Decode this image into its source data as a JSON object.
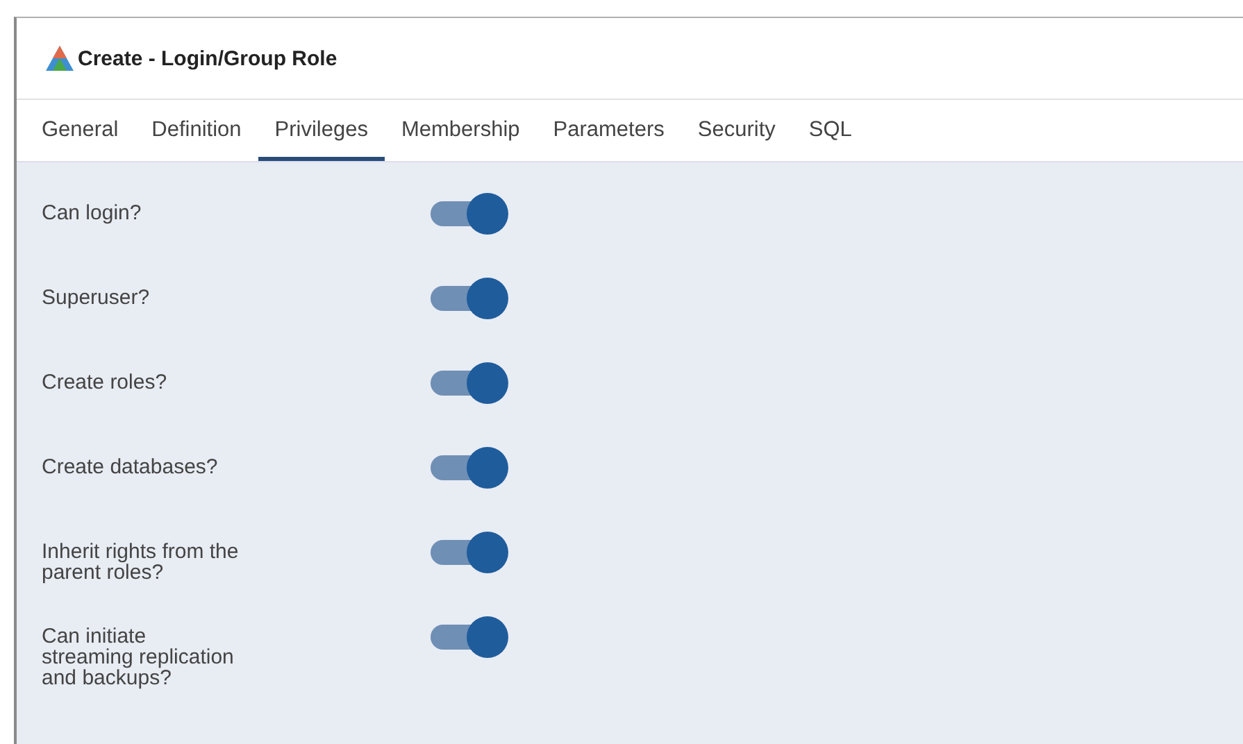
{
  "window": {
    "title": "Create - Login/Group Role"
  },
  "tabs": [
    {
      "label": "General",
      "selected": false
    },
    {
      "label": "Definition",
      "selected": false
    },
    {
      "label": "Privileges",
      "selected": true
    },
    {
      "label": "Membership",
      "selected": false
    },
    {
      "label": "Parameters",
      "selected": false
    },
    {
      "label": "Security",
      "selected": false
    },
    {
      "label": "SQL",
      "selected": false
    }
  ],
  "privileges": [
    {
      "label": "Can login?",
      "on": true
    },
    {
      "label": "Superuser?",
      "on": true
    },
    {
      "label": "Create roles?",
      "on": true
    },
    {
      "label": "Create databases?",
      "on": true
    },
    {
      "label": "Inherit rights from the\nparent roles?",
      "on": true
    },
    {
      "label": "Can initiate\nstreaming replication\nand backups?",
      "on": true
    }
  ]
}
